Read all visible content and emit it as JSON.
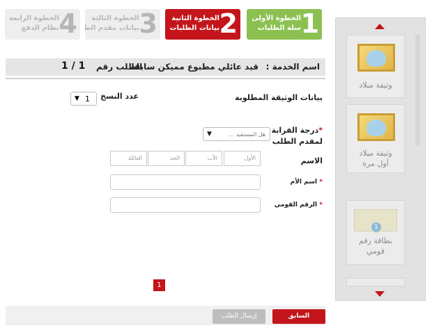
{
  "steps": [
    {
      "number": "1",
      "title": "الخطوة الأولى",
      "subtitle": "سلة الطلبات"
    },
    {
      "number": "2",
      "title": "الخطوة الثانية",
      "subtitle": "بيانات الطلبات"
    },
    {
      "number": "3",
      "title": "الخطوة الثالثة",
      "subtitle": "بيانات مقدم الطلب"
    },
    {
      "number": "4",
      "title": "الخطوة الرابعة",
      "subtitle": "نظام الدفع"
    }
  ],
  "header": {
    "service_label": "اسم الخدمة :",
    "service_value": "قيد عائلي مطبوع مميكن سابقا",
    "request_label": "الطلب رقم",
    "request_count": "1 / 1"
  },
  "form": {
    "doc_data_label": "بيانات الوثيقة المطلوبة",
    "copies_label": "عدد النسخ",
    "copies_value": "1",
    "relation_label_1": "درجة القرابة",
    "relation_label_2": "لمقدم الطلب",
    "relation_placeholder": "هل المستفيد ...",
    "name_label": "الاسم",
    "name_parts": [
      "الأول",
      "الأب",
      "الجد",
      "العائلة"
    ],
    "mother_label": "اسم الأم",
    "national_id_label": "الرقم القومي",
    "required_mark": "*"
  },
  "pagination": {
    "current": "1"
  },
  "buttons": {
    "previous": "السابق",
    "submit": "إرسال الطلب"
  },
  "side_items": [
    {
      "label": "وثيقة ميلاد"
    },
    {
      "label": "وثيقة ميلاد أول مرة"
    },
    {
      "label": "بطاقة رقم قومي",
      "badge": "1"
    }
  ],
  "colors": {
    "primary_red": "#c3151b",
    "step_green": "#8cc152",
    "inactive_gray": "#eeeeee"
  }
}
